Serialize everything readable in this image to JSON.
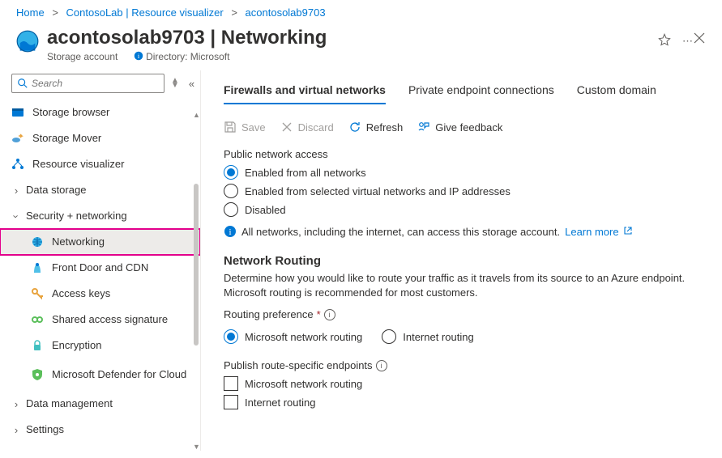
{
  "breadcrumb": {
    "home": "Home",
    "l1": "ContosoLab | Resource visualizer",
    "l2": "acontosolab9703"
  },
  "header": {
    "title": "acontosolab9703 | Networking",
    "subtitle": "Storage account",
    "directory_label": "Directory: Microsoft"
  },
  "sidebar": {
    "search_placeholder": "Search",
    "items": [
      {
        "label": "Storage browser"
      },
      {
        "label": "Storage Mover"
      },
      {
        "label": "Resource visualizer"
      },
      {
        "label": "Data storage"
      },
      {
        "label": "Security + networking"
      },
      {
        "label": "Networking"
      },
      {
        "label": "Front Door and CDN"
      },
      {
        "label": "Access keys"
      },
      {
        "label": "Shared access signature"
      },
      {
        "label": "Encryption"
      },
      {
        "label": "Microsoft Defender for Cloud"
      },
      {
        "label": "Data management"
      },
      {
        "label": "Settings"
      }
    ]
  },
  "tabs": {
    "t0": "Firewalls and virtual networks",
    "t1": "Private endpoint connections",
    "t2": "Custom domain"
  },
  "toolbar": {
    "save": "Save",
    "discard": "Discard",
    "refresh": "Refresh",
    "feedback": "Give feedback"
  },
  "public_access": {
    "label": "Public network access",
    "opt0": "Enabled from all networks",
    "opt1": "Enabled from selected virtual networks and IP addresses",
    "opt2": "Disabled",
    "info": "All networks, including the internet, can access this storage account.",
    "learn_more": "Learn more"
  },
  "routing": {
    "heading": "Network Routing",
    "desc": "Determine how you would like to route your traffic as it travels from its source to an Azure endpoint. Microsoft routing is recommended for most customers.",
    "pref_label": "Routing preference",
    "opt0": "Microsoft network routing",
    "opt1": "Internet routing",
    "publish_label": "Publish route-specific endpoints",
    "chk0": "Microsoft network routing",
    "chk1": "Internet routing"
  }
}
